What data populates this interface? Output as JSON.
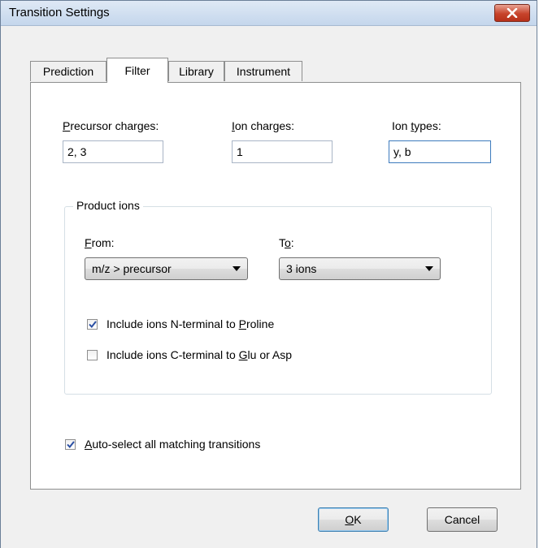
{
  "window": {
    "title": "Transition Settings"
  },
  "tabs": [
    {
      "label": "Prediction"
    },
    {
      "label": "Filter"
    },
    {
      "label": "Library"
    },
    {
      "label": "Instrument"
    }
  ],
  "filter": {
    "precursor_charges": {
      "label_key": "P",
      "label_rest": "recursor charges:",
      "value": "2, 3"
    },
    "ion_charges": {
      "label_key": "I",
      "label_rest": "on charges:",
      "value": "1"
    },
    "ion_types": {
      "label_pre": "Ion ",
      "label_key": "t",
      "label_rest": "ypes:",
      "value": "y, b"
    },
    "product_ions": {
      "title": "Product ions",
      "from": {
        "label_key": "F",
        "label_rest": "rom:",
        "selected": "m/z > precursor"
      },
      "to": {
        "label_pre": "T",
        "label_key": "o",
        "label_rest": ":",
        "selected": "3 ions"
      },
      "n_terminal": {
        "label_pre": "Include ions N-terminal to ",
        "label_key": "P",
        "label_rest": "roline",
        "checked": true
      },
      "c_terminal": {
        "label_pre": "Include ions C-terminal to ",
        "label_key": "G",
        "label_rest": "lu or Asp",
        "checked": false
      }
    },
    "auto_select": {
      "label_key": "A",
      "label_rest": "uto-select all matching transitions",
      "checked": true
    }
  },
  "buttons": {
    "ok": {
      "label_key": "O",
      "label_rest": "K"
    },
    "cancel": {
      "label": "Cancel"
    }
  },
  "icons": {
    "close": "close-icon",
    "combo_arrow": "dropdown-arrow-icon",
    "check": "checkmark-icon"
  },
  "colors": {
    "accent": "#3d7bbd",
    "close_red": "#c7432b"
  }
}
